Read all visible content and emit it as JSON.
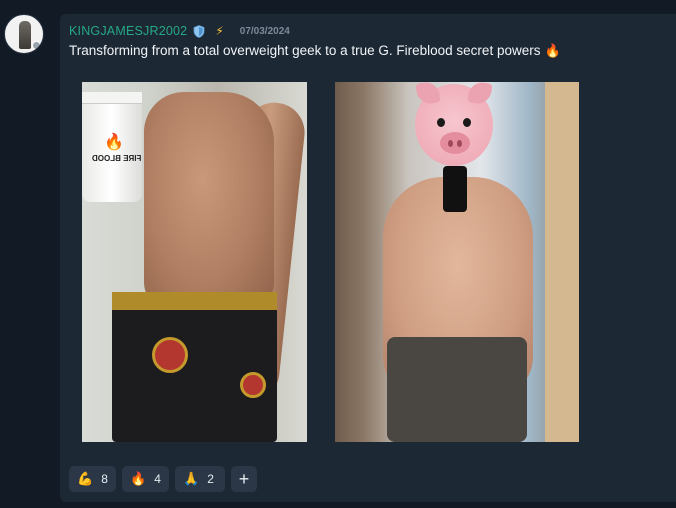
{
  "post": {
    "username": "KINGJAMESJR2002",
    "date": "07/03/2024",
    "message": "Transforming from a total overweight geek to a true G. Fireblood secret powers",
    "message_emoji": "🔥",
    "badges": [
      "shield-icon",
      "lightning-icon"
    ],
    "bolt_glyph": "⚡"
  },
  "images": {
    "left": {
      "description_icon": "fireblood-tub",
      "tub_label": "FIRE BLOOD"
    },
    "right": {
      "overlay": "pig-emoji"
    }
  },
  "reactions": [
    {
      "emoji": "💪",
      "count": "8",
      "icon": "flexed-biceps-icon"
    },
    {
      "emoji": "🔥",
      "count": "4",
      "icon": "fire-icon"
    },
    {
      "emoji": "🙏",
      "count": "2",
      "icon": "folded-hands-icon"
    }
  ],
  "add_reaction_label": "+",
  "colors": {
    "background": "#121a26",
    "card": "#1d2835",
    "username": "#25a886",
    "date": "#7d8a99",
    "reaction_bg": "#2b3746"
  }
}
